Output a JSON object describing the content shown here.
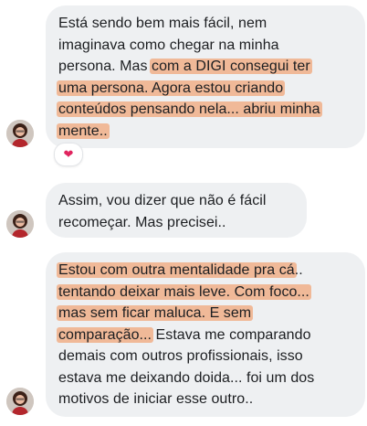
{
  "messages": [
    {
      "lines": [
        [
          {
            "t": "Está sendo bem mais fácil, nem",
            "hl": false
          }
        ],
        [
          {
            "t": "imaginava como chegar na minha",
            "hl": false
          }
        ],
        [
          {
            "t": "persona. Mas ",
            "hl": false
          },
          {
            "t": "com a DIGI consegui ter",
            "hl": true
          }
        ],
        [
          {
            "t": "uma persona. Agora estou criando",
            "hl": true
          }
        ],
        [
          {
            "t": "conteúdos pensando nela... abriu minha",
            "hl": true
          }
        ],
        [
          {
            "t": "mente..",
            "hl": true
          }
        ]
      ],
      "reaction": "❤"
    },
    {
      "lines": [
        [
          {
            "t": "Assim, vou dizer que não é fácil",
            "hl": false
          }
        ],
        [
          {
            "t": "recomeçar.  Mas precisei..",
            "hl": false
          }
        ]
      ]
    },
    {
      "lines": [
        [
          {
            "t": "Estou com outra mentalidade pra cá",
            "hl": true
          },
          {
            "t": "..",
            "hl": false
          }
        ],
        [
          {
            "t": "tentando deixar mais leve. Com foco...",
            "hl": true
          }
        ],
        [
          {
            "t": "mas sem ficar maluca. E sem",
            "hl": true
          }
        ],
        [
          {
            "t": "comparação...",
            "hl": true
          },
          {
            "t": "  Estava me comparando",
            "hl": false
          }
        ],
        [
          {
            "t": "demais com outros profissionais,  isso",
            "hl": false
          }
        ],
        [
          {
            "t": "estava me deixando doida... foi um dos",
            "hl": false
          }
        ],
        [
          {
            "t": "motivos de iniciar esse outro..",
            "hl": false
          }
        ]
      ]
    }
  ],
  "colors": {
    "bubble": "#eef0f2",
    "highlight": "#f0b998",
    "heart": "#e0245e"
  },
  "icons": {
    "avatar": "user-avatar",
    "reaction": "heart-icon"
  }
}
